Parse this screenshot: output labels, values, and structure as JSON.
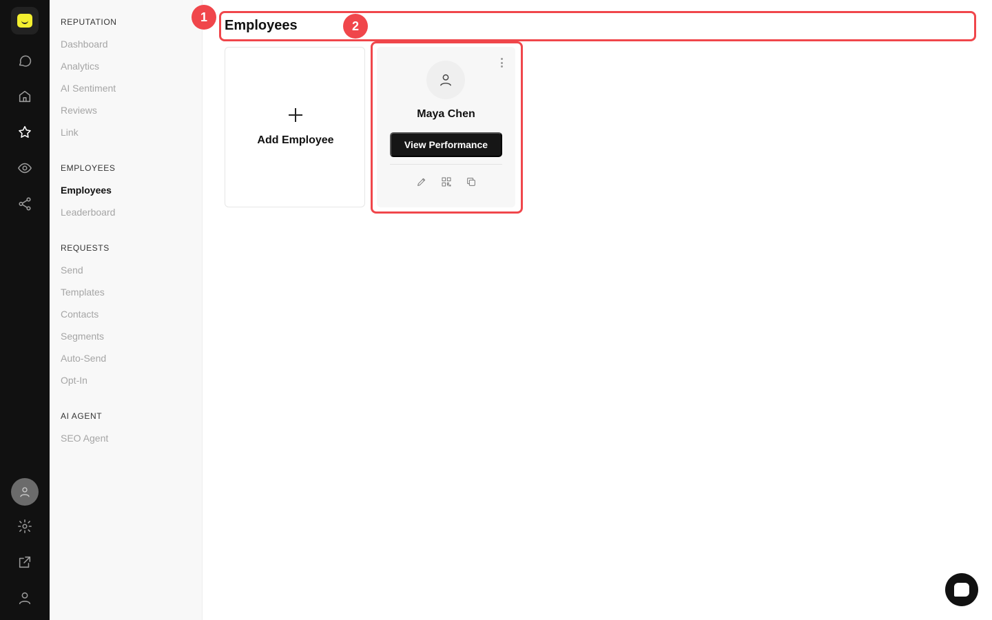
{
  "page": {
    "title": "Employees"
  },
  "sidebar": {
    "sections": [
      {
        "title": "REPUTATION",
        "items": [
          "Dashboard",
          "Analytics",
          "AI Sentiment",
          "Reviews",
          "Link"
        ]
      },
      {
        "title": "EMPLOYEES",
        "items": [
          "Employees",
          "Leaderboard"
        ]
      },
      {
        "title": "REQUESTS",
        "items": [
          "Send",
          "Templates",
          "Contacts",
          "Segments",
          "Auto-Send",
          "Opt-In"
        ]
      },
      {
        "title": "AI AGENT",
        "items": [
          "SEO Agent"
        ]
      }
    ],
    "active_item": "Employees"
  },
  "rail": {
    "icons": [
      "logo-icon",
      "chat-icon",
      "home-icon",
      "star-icon",
      "eye-icon",
      "share-icon"
    ],
    "bottom_icons": [
      "user-avatar-icon",
      "gear-icon",
      "external-link-icon",
      "user-icon"
    ]
  },
  "add_card": {
    "label": "Add Employee"
  },
  "employee_card": {
    "name": "Maya Chen",
    "view_label": "View Performance",
    "actions": [
      "edit-icon",
      "qr-code-icon",
      "copy-icon"
    ]
  },
  "annotations": {
    "badge1": "1",
    "badge2": "2"
  },
  "colors": {
    "accent": "#f0464b",
    "logo": "#f3ef2f",
    "rail_bg": "#111111",
    "button": "#161616"
  }
}
